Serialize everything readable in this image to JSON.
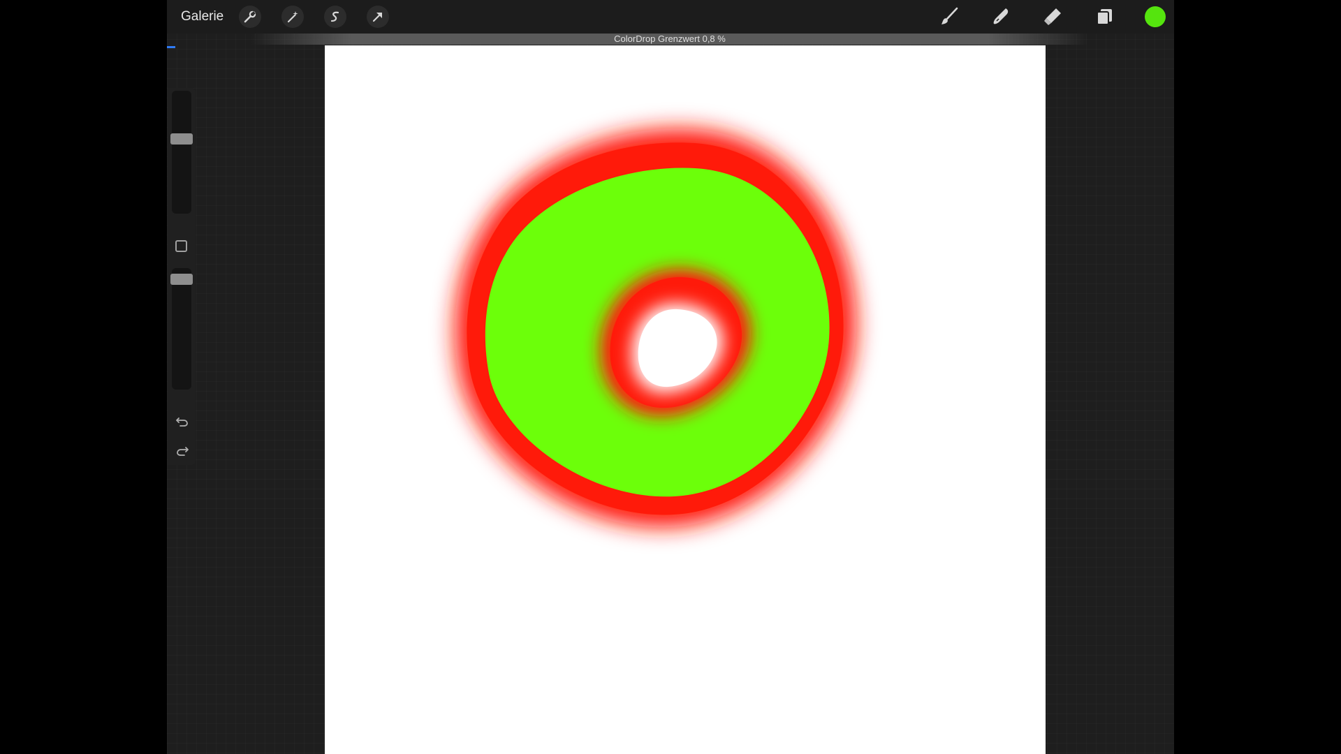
{
  "topbar": {
    "gallery_label": "Galerie",
    "left_tools": [
      "wrench-icon",
      "magic-wand-icon",
      "selection-icon",
      "transform-arrow-icon"
    ],
    "right_tools": [
      "brush-icon",
      "smudge-icon",
      "eraser-icon",
      "layers-icon"
    ],
    "current_color": "#55e40e"
  },
  "notice": {
    "text": "ColorDrop Grenzwert 0,8 %"
  },
  "sidebar": {
    "brush_size_level": 0.62,
    "opacity_level": 0.95,
    "icons": [
      "modify-square-icon",
      "undo-icon",
      "redo-icon"
    ]
  },
  "canvas": {
    "background": "#ffffff",
    "stroke_colors": {
      "fill": "#6cff0a",
      "outline": "#ff1a0a"
    }
  }
}
